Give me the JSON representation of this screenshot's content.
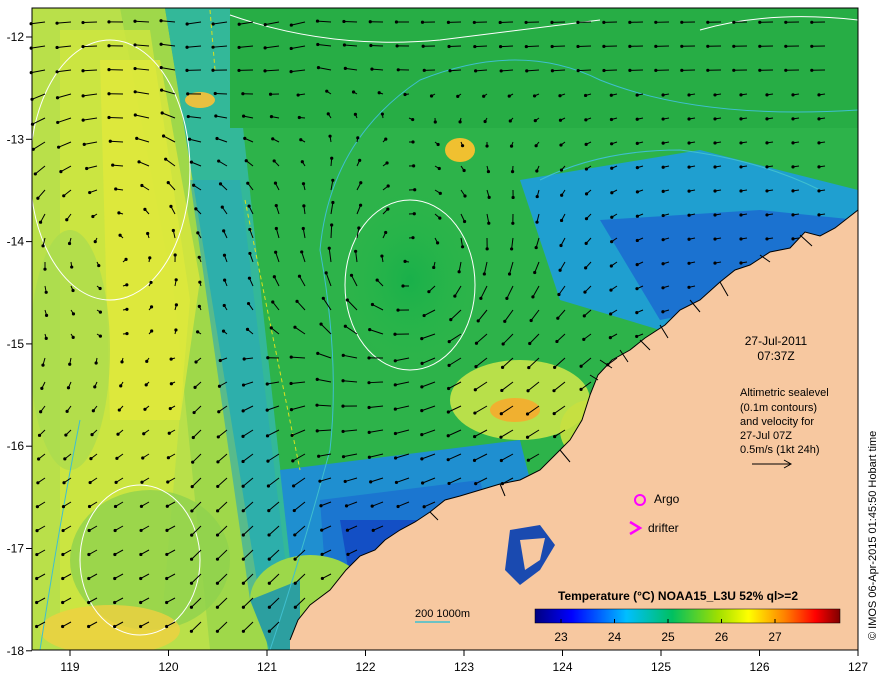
{
  "map": {
    "date_line": "27-Jul-2011",
    "time_line": "07:37Z",
    "info_lines": [
      "Altimetric sealevel",
      "(0.1m contours)",
      "and velocity for",
      "27-Jul 07Z",
      "0.5m/s (1kt 24h)"
    ],
    "markers": {
      "argo_label": "Argo",
      "drifter_label": "drifter",
      "argo_color": "#ff00ff",
      "drifter_color": "#ff00ff"
    },
    "depth_label": "200  1000m",
    "depth_color": "#3fbfcf",
    "credit": "© IMOS 06-Apr-2015 01:45:50 Hobart time",
    "land_color": "#f7c8a0",
    "colorbar": {
      "title": "Temperature (°C) NOAA15_L3U 52% ql>=2",
      "ticks": [
        "23",
        "24",
        "25",
        "26",
        "27"
      ]
    },
    "axes": {
      "x_ticks": [
        "119",
        "120",
        "121",
        "122",
        "123",
        "124",
        "125",
        "126",
        "127"
      ],
      "y_ticks": [
        "-12",
        "-13",
        "-14",
        "-15",
        "-16",
        "-17",
        "-18"
      ]
    }
  }
}
